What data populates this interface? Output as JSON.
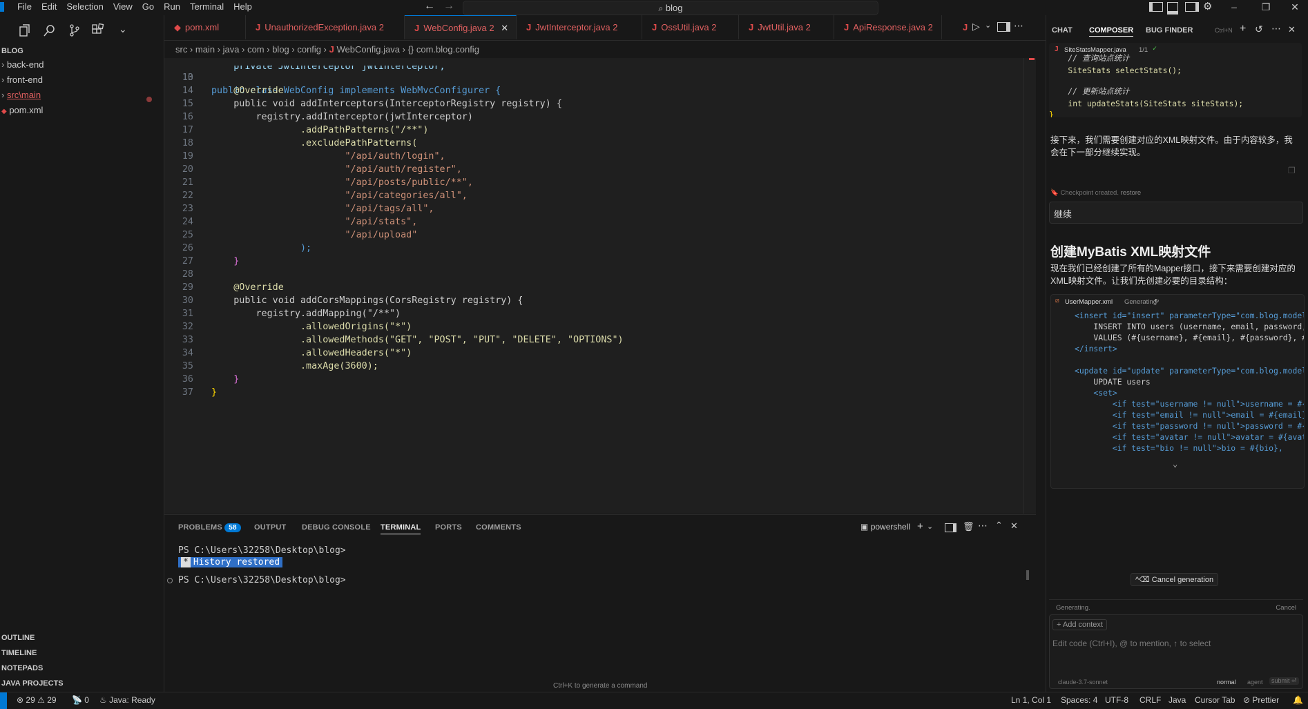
{
  "menu": [
    "File",
    "Edit",
    "Selection",
    "View",
    "Go",
    "Run",
    "Terminal",
    "Help"
  ],
  "search": {
    "text": "blog"
  },
  "explorer": {
    "title": "BLOG",
    "items": [
      {
        "label": "back-end"
      },
      {
        "label": "front-end"
      },
      {
        "label": "src\\main"
      },
      {
        "label": "pom.xml"
      }
    ],
    "sections": [
      "OUTLINE",
      "TIMELINE",
      "NOTEPADS",
      "JAVA PROJECTS"
    ]
  },
  "tabs": [
    {
      "label": "pom.xml",
      "badge": ""
    },
    {
      "label": "UnauthorizedException.java",
      "badge": "2"
    },
    {
      "label": "WebConfig.java",
      "badge": "2"
    },
    {
      "label": "JwtInterceptor.java",
      "badge": "2"
    },
    {
      "label": "OssUtil.java",
      "badge": "2"
    },
    {
      "label": "JwtUtil.java",
      "badge": "2"
    },
    {
      "label": "ApiResponse.java",
      "badge": "2"
    }
  ],
  "breadcrumb": [
    "src",
    "main",
    "java",
    "com",
    "blog",
    "config",
    "WebConfig.java",
    "{} com.blog.config"
  ],
  "editor": {
    "lines": [
      {
        "n": "10",
        "t": "public class WebConfig implements WebMvcConfigurer {"
      },
      {
        "n": "13",
        "t": ""
      },
      {
        "n": "14",
        "t": "    @Override"
      },
      {
        "n": "15",
        "t": "    public void addInterceptors(InterceptorRegistry registry) {"
      },
      {
        "n": "16",
        "t": "        registry.addInterceptor(jwtInterceptor)"
      },
      {
        "n": "17",
        "t": "                .addPathPatterns(\"/**\")"
      },
      {
        "n": "18",
        "t": "                .excludePathPatterns("
      },
      {
        "n": "19",
        "t": "                        \"/api/auth/login\","
      },
      {
        "n": "20",
        "t": "                        \"/api/auth/register\","
      },
      {
        "n": "21",
        "t": "                        \"/api/posts/public/**\","
      },
      {
        "n": "22",
        "t": "                        \"/api/categories/all\","
      },
      {
        "n": "23",
        "t": "                        \"/api/tags/all\","
      },
      {
        "n": "24",
        "t": "                        \"/api/stats\","
      },
      {
        "n": "25",
        "t": "                        \"/api/upload\""
      },
      {
        "n": "26",
        "t": "                );"
      },
      {
        "n": "27",
        "t": "    }"
      },
      {
        "n": "28",
        "t": ""
      },
      {
        "n": "29",
        "t": "    @Override"
      },
      {
        "n": "30",
        "t": "    public void addCorsMappings(CorsRegistry registry) {"
      },
      {
        "n": "31",
        "t": "        registry.addMapping(\"/**\")"
      },
      {
        "n": "32",
        "t": "                .allowedOrigins(\"*\")"
      },
      {
        "n": "33",
        "t": "                .allowedMethods(\"GET\", \"POST\", \"PUT\", \"DELETE\", \"OPTIONS\")"
      },
      {
        "n": "34",
        "t": "                .allowedHeaders(\"*\")"
      },
      {
        "n": "35",
        "t": "                .maxAge(3600);"
      },
      {
        "n": "36",
        "t": "    }"
      },
      {
        "n": "37",
        "t": "}"
      }
    ],
    "sticky_partial": "    private JwtInterceptor jwtInterceptor;"
  },
  "panel": {
    "tabs": [
      "PROBLEMS",
      "OUTPUT",
      "DEBUG CONSOLE",
      "TERMINAL",
      "PORTS",
      "COMMENTS"
    ],
    "problems_count": "58",
    "shell": "powershell",
    "terminal": {
      "prompt1": "PS C:\\Users\\32258\\Desktop\\blog>",
      "restored": "History restored",
      "prompt2": "PS C:\\Users\\32258\\Desktop\\blog>"
    },
    "hint": "Ctrl+K to generate a command"
  },
  "chat": {
    "tabs": [
      "CHAT",
      "COMPOSER",
      "BUG FINDER"
    ],
    "new_shortcut": "Ctrl+N",
    "file_card": {
      "name": "SiteStatsMapper.java",
      "count": "1/1",
      "lines": [
        "    // 查询站点统计",
        "    SiteStats selectStats();",
        "",
        "    // 更新站点统计",
        "    int updateStats(SiteStats siteStats);",
        "}"
      ]
    },
    "para1": "接下来，我们需要创建对应的XML映射文件。由于内容较多，我会在下一部分继续实现。",
    "checkpoint": "Checkpoint created.",
    "restore": "restore",
    "user_msg": "继续",
    "heading": "创建MyBatis XML映射文件",
    "para2": "现在我们已经创建了所有的Mapper接口，接下来需要创建对应的XML映射文件。让我们先创建必要的目录结构：",
    "xml_card": {
      "name": "UserMapper.xml",
      "status": "Generating",
      "lines": [
        "<insert id=\"insert\" parameterType=\"com.blog.model",
        "    INSERT INTO users (username, email, password,",
        "    VALUES (#{username}, #{email}, #{password}, #",
        "</insert>",
        "",
        "<update id=\"update\" parameterType=\"com.blog.model",
        "    UPDATE users",
        "    <set>",
        "        <if test=\"username != null\">username = #{",
        "        <if test=\"email != null\">email = #{email}",
        "        <if test=\"password != null\">password = #{",
        "        <if test=\"avatar != null\">avatar = #{avat",
        "        <if test=\"bio != null\">bio = #{bio},"
      ]
    },
    "cancel_gen": "^⌫ Cancel generation",
    "generating": "Generating.",
    "cancel": "Cancel",
    "add_context": "+ Add context",
    "input_placeholder": "Edit code (Ctrl+I), @ to mention, ↑ to select",
    "model": "claude-3.7-sonnet",
    "mode_normal": "normal",
    "mode_agent": "agent",
    "submit": "submit ⏎"
  },
  "status": {
    "errors": "29",
    "warnings": "29",
    "ports": "0",
    "java": "Java: Ready",
    "position": "Ln 1, Col 1",
    "spaces": "Spaces: 4",
    "encoding": "UTF-8",
    "eol": "CRLF",
    "lang": "Java",
    "cursor_tab": "Cursor Tab",
    "prettier": "Prettier"
  },
  "colors": {
    "accent": "#0078d4",
    "error_tab": "#e06060",
    "background": "#181818",
    "editor_bg": "#1f1f1f"
  }
}
